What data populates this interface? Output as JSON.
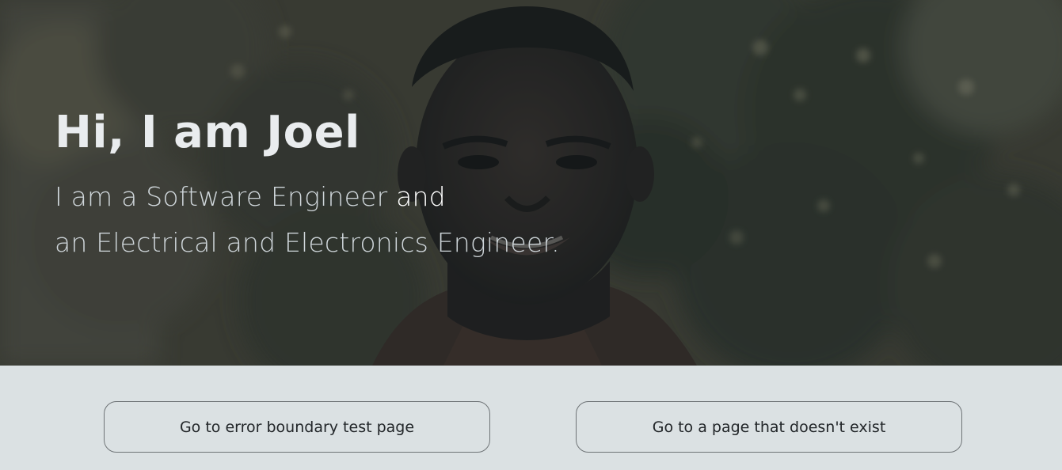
{
  "hero": {
    "title": "Hi, I am Joel",
    "line1_main": "I am a Software Engineer ",
    "line1_accent": "and",
    "line2": "an Electrical and Electronics Engineer."
  },
  "actions": {
    "error_boundary_label": "Go to error boundary test page",
    "not_found_label": "Go to a page that doesn't exist"
  },
  "colors": {
    "page_background": "#dbe1e3",
    "hero_overlay": "#1f2a2e",
    "button_border": "#6f7477",
    "text_light": "#e9ecee"
  }
}
